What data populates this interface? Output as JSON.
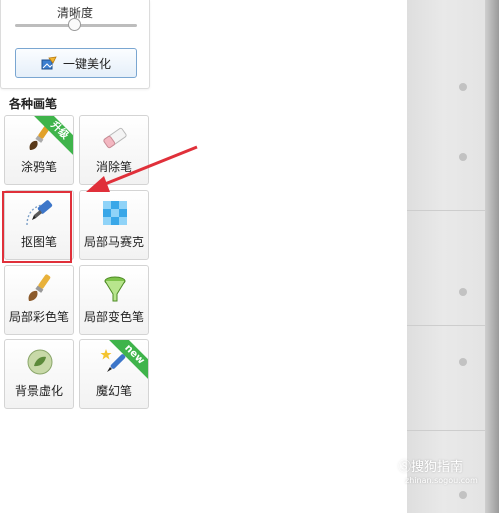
{
  "top": {
    "clarity_label": "清晰度",
    "slider_value_pct": 50,
    "beautify_label": "一键美化"
  },
  "section_title": "各种画笔",
  "tools": [
    {
      "label": "涂鸦笔",
      "badge": "升级"
    },
    {
      "label": "消除笔"
    },
    {
      "label": "抠图笔"
    },
    {
      "label": "局部马赛克"
    },
    {
      "label": "局部彩色笔"
    },
    {
      "label": "局部变色笔"
    },
    {
      "label": "背景虚化"
    },
    {
      "label": "魔幻笔",
      "badge": "new"
    }
  ],
  "watermark": {
    "text": "搜狗指南",
    "url": "zhinan.sogou.com"
  },
  "colors": {
    "highlight": "#e0303a",
    "badge": "#3fb44b",
    "arrow": "#e0303a"
  }
}
